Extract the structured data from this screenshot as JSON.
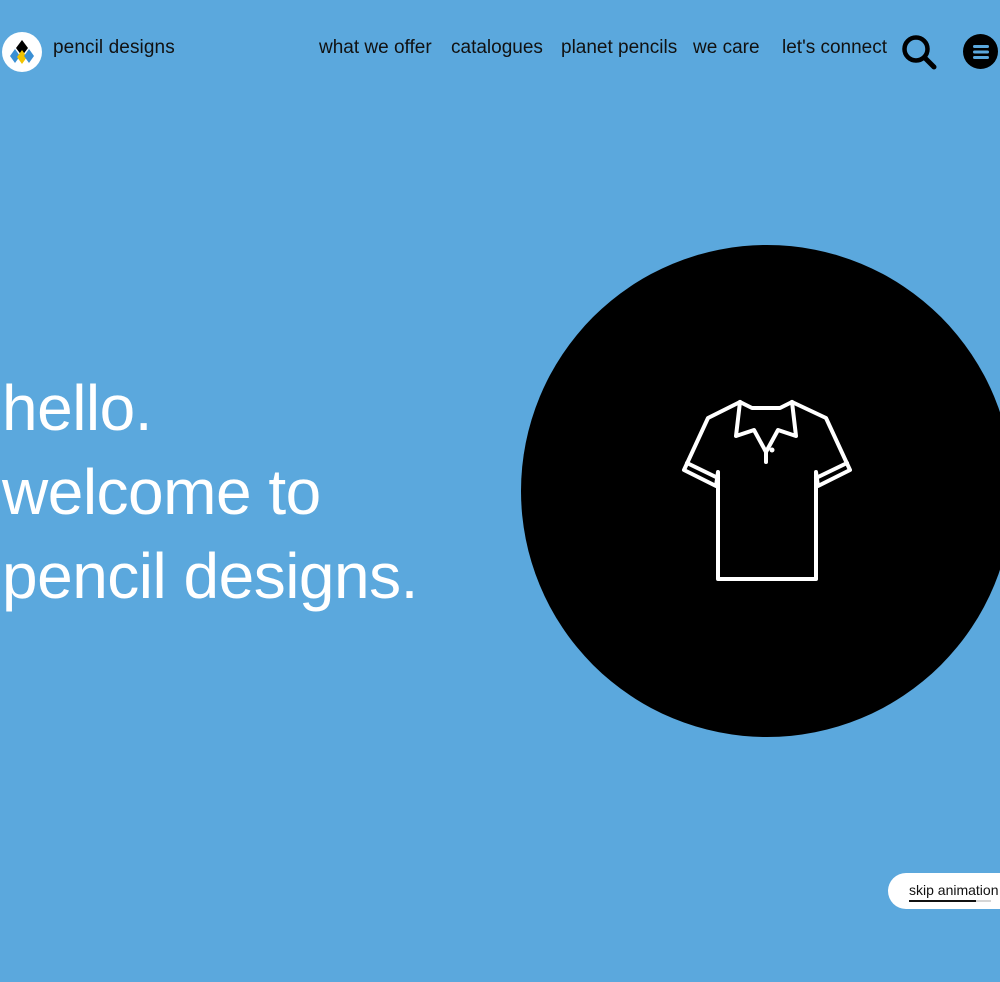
{
  "brand": {
    "name": "pencil designs",
    "logo_colors": [
      "#000000",
      "#f2c400",
      "#3a8fd4"
    ]
  },
  "nav": {
    "items": [
      {
        "label": "what we offer"
      },
      {
        "label": "catalogues"
      },
      {
        "label": "planet pencils"
      },
      {
        "label": "we care"
      },
      {
        "label": "let's connect"
      }
    ],
    "search_icon": "search-icon",
    "menu_icon": "hamburger-menu-icon"
  },
  "hero": {
    "line1": "hello.",
    "line2": "welcome to",
    "line3": "pencil designs."
  },
  "animation": {
    "icon": "polo-shirt-icon",
    "skip_label": "skip animation",
    "progress": 0.82
  },
  "colors": {
    "background": "#5ba8dd",
    "circle": "#000000",
    "text_light": "#ffffff",
    "text_dark": "#111111"
  }
}
